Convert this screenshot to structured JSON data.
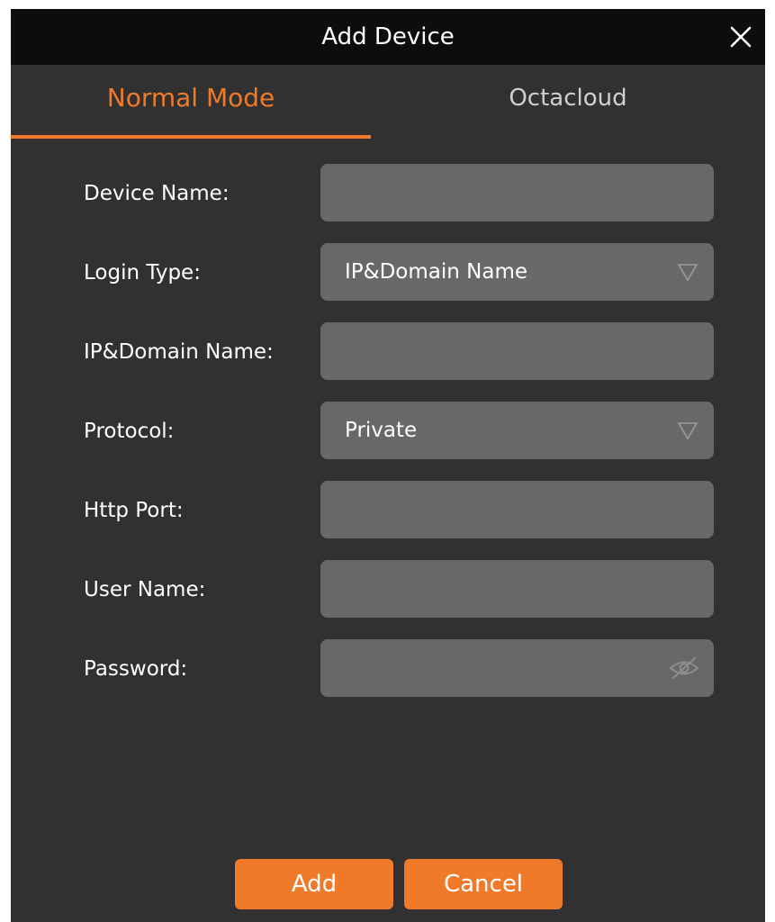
{
  "dialog": {
    "title": "Add Device",
    "close_icon": "close-icon"
  },
  "tabs": [
    {
      "label": "Normal Mode",
      "active": true
    },
    {
      "label": "Octacloud",
      "active": false
    }
  ],
  "form": {
    "device_name": {
      "label": "Device Name:",
      "value": ""
    },
    "login_type": {
      "label": "Login Type:",
      "value": "IP&Domain Name",
      "icon": "dropdown-triangle-icon"
    },
    "ip_domain": {
      "label": "IP&Domain Name:",
      "value": ""
    },
    "protocol": {
      "label": "Protocol:",
      "value": "Private",
      "icon": "dropdown-triangle-icon"
    },
    "http_port": {
      "label": "Http Port:",
      "value": ""
    },
    "user_name": {
      "label": "User Name:",
      "value": ""
    },
    "password": {
      "label": "Password:",
      "value": "",
      "icon": "eye-hidden-icon"
    }
  },
  "buttons": {
    "add": "Add",
    "cancel": "Cancel"
  },
  "colors": {
    "accent": "#ee7a2a",
    "dialog_bg": "#313131",
    "titlebar_bg": "#0d0d0d",
    "field_bg": "#686868"
  }
}
